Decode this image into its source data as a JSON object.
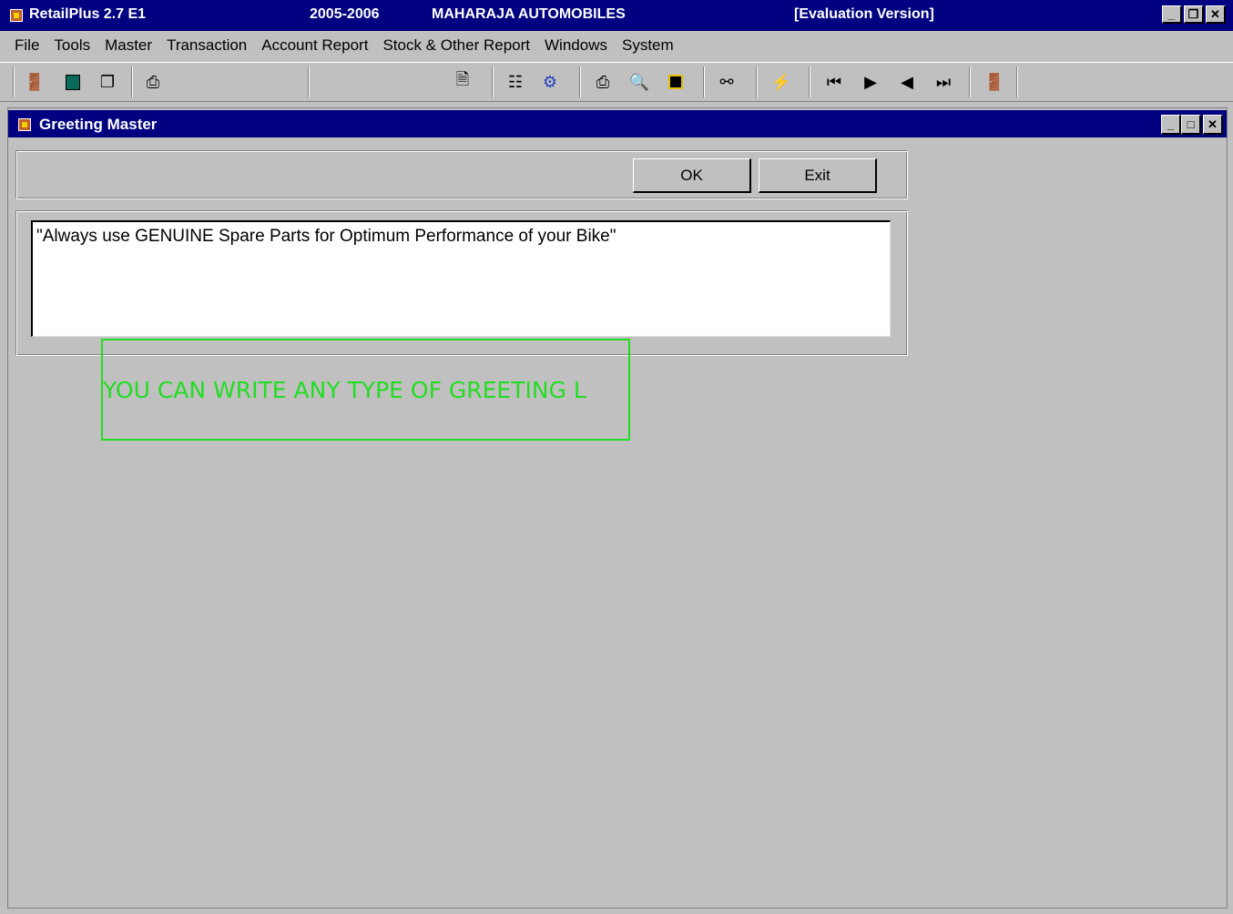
{
  "app": {
    "name": "RetailPlus 2.7 E1",
    "year": "2005-2006",
    "company": "MAHARAJA AUTOMOBILES",
    "edition": "[Evaluation Version]"
  },
  "menu": [
    "File",
    "Tools",
    "Master",
    "Transaction",
    "Account Report",
    "Stock & Other Report",
    "Windows",
    "System"
  ],
  "toolbar_icons": [
    "exit-door-icon",
    "calculator-icon",
    "copy-icon",
    "print-icon",
    "new-document-icon",
    "grid-icon",
    "bicycle-icon",
    "print-icon",
    "print-preview-icon",
    "save-icon",
    "find-icon",
    "refresh-icon",
    "first-record-icon",
    "next-record-icon",
    "previous-record-icon",
    "last-record-icon",
    "exit-door-icon"
  ],
  "window": {
    "title": "Greeting Master",
    "ok_label": "OK",
    "exit_label": "Exit",
    "greeting_text": "\"Always use GENUINE Spare Parts for Optimum Performance of your Bike\""
  },
  "annotation": {
    "text": "YOU CAN WRITE ANY TYPE OF GREETING L",
    "color": "#22dd22"
  },
  "colors": {
    "titlebar": "#000080",
    "face": "#c0c0c0"
  }
}
